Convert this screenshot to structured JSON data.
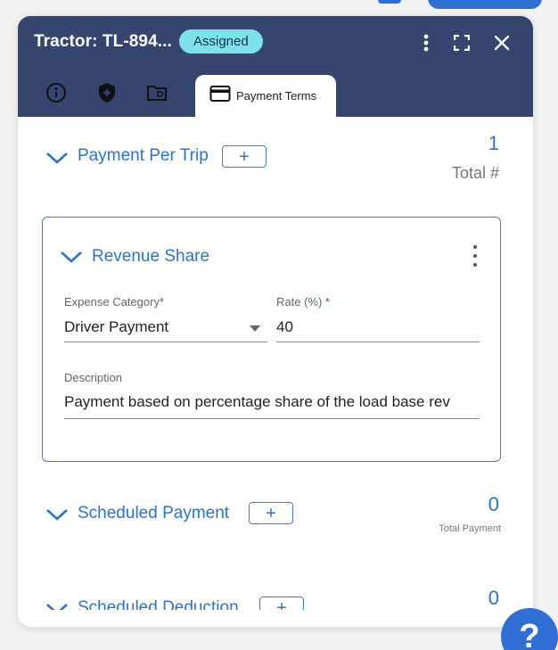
{
  "window": {
    "title": "Tractor: TL-894...",
    "status": "Assigned"
  },
  "tabs": {
    "active_label": "Payment Terms",
    "icons": [
      "info-icon",
      "shield-plus-icon",
      "folder-icon",
      "credit-card-icon"
    ]
  },
  "payment_per_trip": {
    "title": "Payment Per Trip",
    "add_label": "+",
    "count": "1",
    "count_label": "Total #"
  },
  "revenue_share": {
    "title": "Revenue Share",
    "expense_category_label": "Expense Category*",
    "expense_category_value": "Driver Payment",
    "rate_label": "Rate (%)",
    "rate_required": "*",
    "rate_value": "40",
    "description_label": "Description",
    "description_value": "Payment based on percentage share of the load base rev"
  },
  "scheduled_payment": {
    "title": "Scheduled Payment",
    "add_label": "+",
    "count": "0",
    "count_label": "Total Payment"
  },
  "scheduled_deduction": {
    "title": "Scheduled Deduction",
    "add_label": "+",
    "count": "0"
  },
  "help": {
    "label": "?"
  },
  "colors": {
    "header": "#35456e",
    "accent": "#2e72c7",
    "badge": "#7ee1ea",
    "help_button": "#2f6fd6"
  }
}
